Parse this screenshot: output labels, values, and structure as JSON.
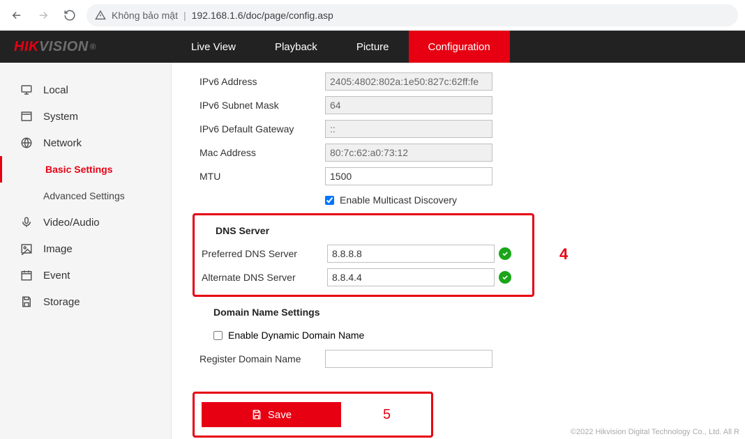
{
  "browser": {
    "security_text": "Không bảo mật",
    "url": "192.168.1.6/doc/page/config.asp"
  },
  "logo": {
    "hik": "HIK",
    "vision": "VISION",
    "reg": "®"
  },
  "nav": {
    "live": "Live View",
    "playback": "Playback",
    "picture": "Picture",
    "config": "Configuration"
  },
  "sidebar": {
    "local": "Local",
    "system": "System",
    "network": "Network",
    "basic": "Basic Settings",
    "advanced": "Advanced Settings",
    "video": "Video/Audio",
    "image": "Image",
    "event": "Event",
    "storage": "Storage"
  },
  "form": {
    "ipv6_addr_label": "IPv6 Address",
    "ipv6_addr_value": "2405:4802:802a:1e50:827c:62ff:fe",
    "ipv6_mask_label": "IPv6 Subnet Mask",
    "ipv6_mask_value": "64",
    "ipv6_gw_label": "IPv6 Default Gateway",
    "ipv6_gw_value": "::",
    "mac_label": "Mac Address",
    "mac_value": "80:7c:62:a0:73:12",
    "mtu_label": "MTU",
    "mtu_value": "1500",
    "multicast_label": "Enable Multicast Discovery",
    "dns_section": "DNS Server",
    "pref_dns_label": "Preferred DNS Server",
    "pref_dns_value": "8.8.8.8",
    "alt_dns_label": "Alternate DNS Server",
    "alt_dns_value": "8.8.4.4",
    "domain_section": "Domain Name Settings",
    "dyn_domain_label": "Enable Dynamic Domain Name",
    "reg_domain_label": "Register Domain Name",
    "reg_domain_value": "",
    "save_label": "Save"
  },
  "annot": {
    "four": "4",
    "five": "5"
  },
  "footer": "©2022 Hikvision Digital Technology Co., Ltd. All R"
}
